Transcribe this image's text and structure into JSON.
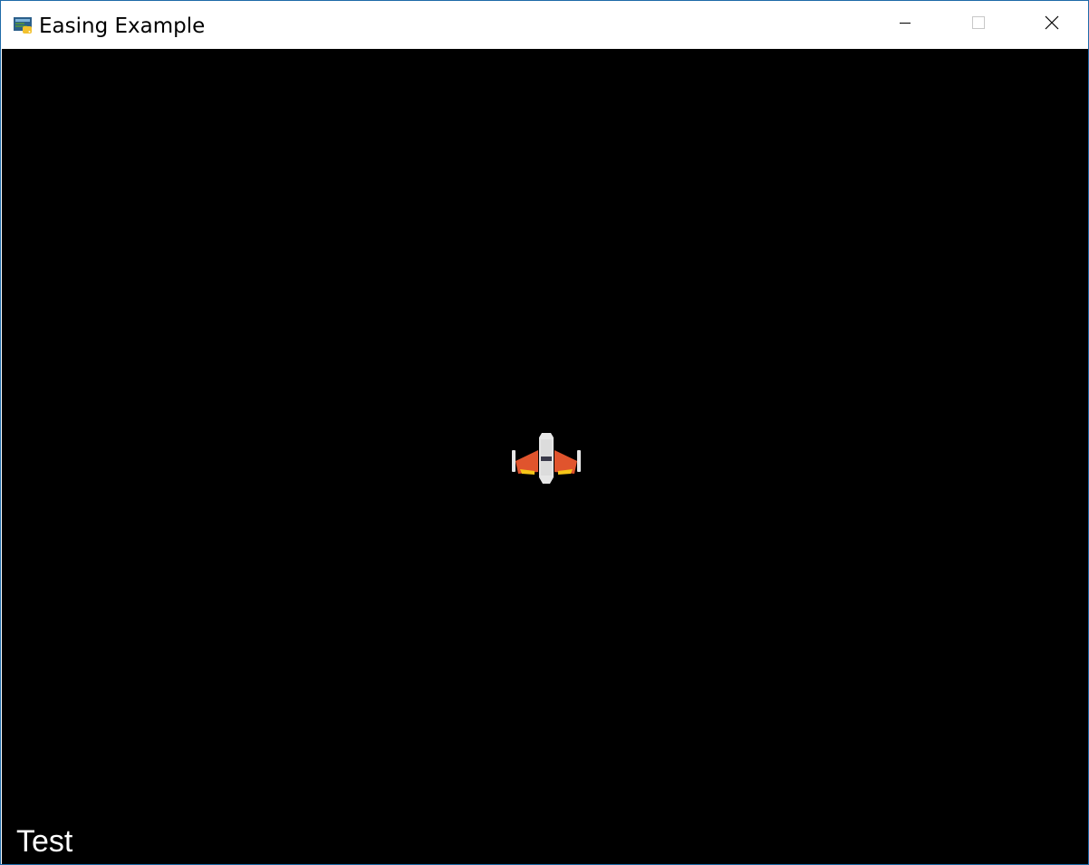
{
  "window": {
    "title": "Easing Example",
    "icon": "python-icon",
    "controls": {
      "minimize": "minimize-icon",
      "maximize": "maximize-icon",
      "close": "close-icon"
    }
  },
  "game": {
    "background_color": "#000000",
    "sprite": "spaceship-sprite",
    "hud_text": "Test"
  },
  "colors": {
    "border_accent": "#1e6aa8",
    "ship_hull": "#e6e6e6",
    "ship_wings": "#e0542d",
    "ship_thrusters": "#f5c518",
    "hud_text": "#ffffff"
  }
}
